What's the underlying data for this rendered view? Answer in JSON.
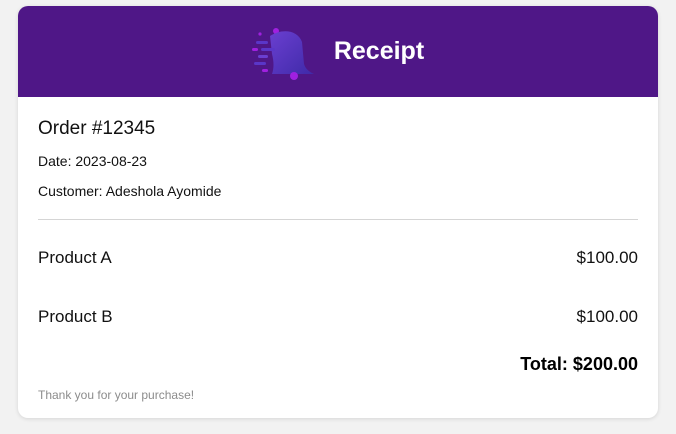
{
  "header": {
    "title": "Receipt",
    "logo_icon": "bell-logo-icon",
    "background_color": "#4f1787"
  },
  "order": {
    "title": "Order #12345",
    "date": "Date: 2023-08-23",
    "customer": "Customer: Adeshola Ayomide"
  },
  "items": [
    {
      "name": "Product A",
      "price": "$100.00"
    },
    {
      "name": "Product B",
      "price": "$100.00"
    }
  ],
  "total": "Total: $200.00",
  "footer": {
    "thanks": "Thank you for your purchase!"
  }
}
